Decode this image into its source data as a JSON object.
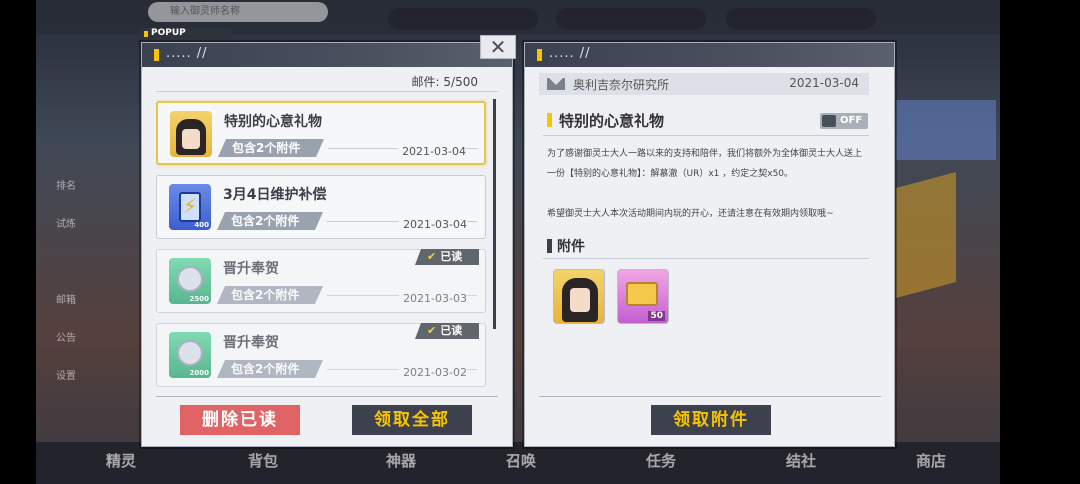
{
  "background": {
    "search_placeholder": "输入御灵师名称",
    "sidenav": [
      "",
      "排名",
      "试炼",
      "",
      "邮箱",
      "公告",
      "设置"
    ],
    "bottom_nav": [
      "精灵",
      "背包",
      "神器",
      "召唤",
      "任务",
      "结社",
      "商店"
    ]
  },
  "popup_tag": "POPUP",
  "close_label": "✕",
  "left_panel": {
    "header": "..... //",
    "mail_count_label": "邮件: 5/500",
    "mails": [
      {
        "title": "特别的心意礼物",
        "badge": "包含2个附件",
        "date": "2021-03-04",
        "icon": "character-portrait-icon",
        "qty": "",
        "read": false,
        "selected": true
      },
      {
        "title": "3月4日维护补偿",
        "badge": "包含2个附件",
        "date": "2021-03-04",
        "icon": "battery-icon",
        "qty": "400",
        "read": false,
        "selected": false
      },
      {
        "title": "晋升奉贺",
        "badge": "包含2个附件",
        "date": "2021-03-03",
        "icon": "coin-icon",
        "qty": "2500",
        "read": true,
        "selected": false
      },
      {
        "title": "晋升奉贺",
        "badge": "包含2个附件",
        "date": "2021-03-02",
        "icon": "coin-icon",
        "qty": "2000",
        "read": true,
        "selected": false
      }
    ],
    "read_tag": "已读",
    "delete_read_label": "删除已读",
    "claim_all_label": "领取全部"
  },
  "right_panel": {
    "header": "..... //",
    "sender": "奥利吉奈尔研究所",
    "date": "2021-03-04",
    "title": "特别的心意礼物",
    "lock_state": "OFF",
    "body_line1": "为了感谢御灵士大人一路以来的支持和陪伴，我们将额外为全体御灵士大人送上",
    "body_line2": "一份【特别的心意礼物】：解慕澈（UR）x1 ，约定之契x50。",
    "body_line3": "希望御灵士大人本次活动期间内玩的开心，还请注意在有效期内领取哦~",
    "attachments_title": "附件",
    "attachments": [
      {
        "icon": "character-portrait-icon",
        "qty": ""
      },
      {
        "icon": "contract-ticket-icon",
        "qty": "50"
      }
    ],
    "claim_attachments_label": "领取附件"
  },
  "colors": {
    "accent_yellow": "#f6c400",
    "delete_red": "#e06466",
    "dark_button": "#3c414d"
  }
}
